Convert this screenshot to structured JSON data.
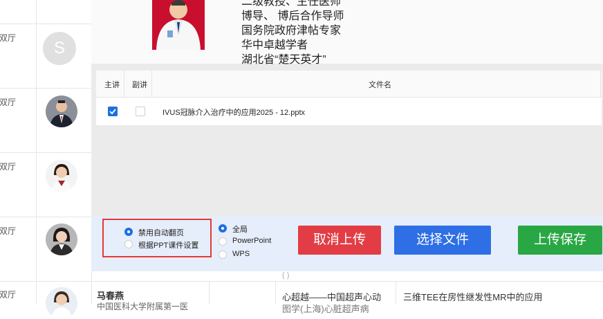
{
  "background_table": {
    "venue_fragment": "双厅",
    "avatar_letter": "S",
    "bottom_row": {
      "name": "马春燕",
      "hospital_fragment": "中国医科大学附属第一医",
      "meeting_fragment": "心超越——中国超声心动",
      "meeting_fragment_2": "图学(上海)心脏超声病",
      "talk_title": "三维TEE在房性继发性MR中的应用"
    }
  },
  "modal": {
    "bio_lines": [
      "二级教授、主任医师",
      "博导、 博后合作导师",
      "国务院政府津帖专家",
      "华中卓越学者",
      "湖北省“楚天英才”"
    ],
    "file_table": {
      "headers": {
        "main": "主讲",
        "sub": "副讲",
        "filename": "文件名"
      },
      "rows": [
        {
          "main_checked": true,
          "sub_checked": false,
          "filename": "IVUS冠脉介入治疗中的应用2025 - 12.pptx"
        }
      ]
    },
    "footer": {
      "page_turn_options": [
        {
          "label": "禁用自动翻页",
          "selected": true
        },
        {
          "label": "根据PPT课件设置",
          "selected": false
        }
      ],
      "scope_options": [
        {
          "label": "全局",
          "selected": true
        },
        {
          "label": "PowerPoint",
          "selected": false
        },
        {
          "label": "WPS",
          "selected": false
        }
      ],
      "cancel_label": "取消上传",
      "choose_label": "选择文件",
      "save_label": "上传保存"
    }
  },
  "colors": {
    "primary": "#1e6fe0",
    "danger": "#e23d45",
    "success": "#2aa745",
    "highlight_border": "#e53935"
  }
}
